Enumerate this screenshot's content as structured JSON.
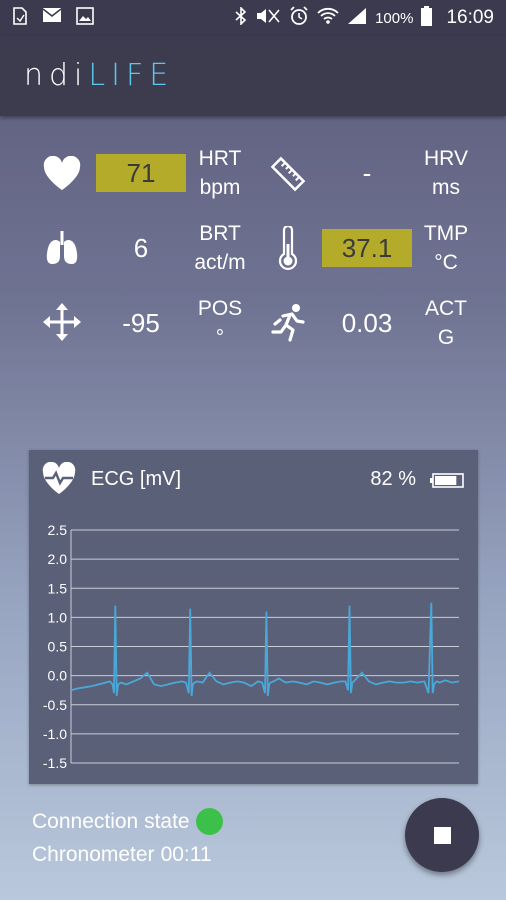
{
  "status_bar": {
    "left_icons": [
      "sim-icon",
      "mail-icon",
      "image-icon"
    ],
    "right_icons": [
      "bluetooth-icon",
      "mute-icon",
      "alarm-icon",
      "wifi-icon",
      "signal-icon"
    ],
    "battery_percent": "100%",
    "time": "16:09"
  },
  "app": {
    "logo_part1": "ndi",
    "logo_part2": "LIFE"
  },
  "metrics": {
    "hrt": {
      "icon": "heart-icon",
      "value": "71",
      "unit_line1": "HRT",
      "unit_line2": "bpm",
      "highlighted": true
    },
    "hrv": {
      "icon": "ruler-icon",
      "value": "-",
      "unit_line1": "HRV",
      "unit_line2": "ms",
      "highlighted": false
    },
    "brt": {
      "icon": "lungs-icon",
      "value": "6",
      "unit_line1": "BRT",
      "unit_line2": "act/m",
      "highlighted": false
    },
    "tmp": {
      "icon": "thermometer-icon",
      "value": "37.1",
      "unit_line1": "TMP",
      "unit_line2": "°C",
      "highlighted": true
    },
    "pos": {
      "icon": "move-arrows-icon",
      "value": "-95",
      "unit_line1": "POS",
      "unit_line2": "°",
      "highlighted": false
    },
    "act": {
      "icon": "running-icon",
      "value": "0.03",
      "unit_line1": "ACT",
      "unit_line2": "G",
      "highlighted": false
    }
  },
  "ecg": {
    "title": "ECG [mV]",
    "battery": "82 %",
    "battery_level": 0.82
  },
  "chart_data": {
    "type": "line",
    "title": "ECG [mV]",
    "xlabel": "",
    "ylabel": "",
    "ylim": [
      -1.5,
      2.5
    ],
    "yticks": [
      "2.5",
      "2.0",
      "1.5",
      "1.0",
      "0.5",
      "0.0",
      "-0.5",
      "-1.0",
      "-1.5"
    ],
    "grid": true,
    "series": [
      {
        "color": "#4aa8d8",
        "x": [
          0,
          5,
          10,
          15,
          20,
          25,
          28,
          30,
          31,
          32,
          33,
          34,
          36,
          40,
          50,
          55,
          60,
          65,
          70,
          75,
          80,
          83,
          85,
          86,
          87,
          88,
          89,
          91,
          95,
          100,
          105,
          110,
          115,
          120,
          125,
          130,
          135,
          138,
          140,
          141,
          142,
          143,
          144,
          146,
          150,
          155,
          160,
          165,
          170,
          175,
          180,
          185,
          190,
          195,
          198,
          200,
          201,
          202,
          203,
          204,
          206,
          210,
          215,
          220,
          225,
          230,
          235,
          240,
          245,
          250,
          255,
          258,
          260,
          261,
          262,
          263,
          264,
          266,
          270,
          275,
          280
        ],
        "values": [
          -0.25,
          -0.22,
          -0.2,
          -0.18,
          -0.15,
          -0.12,
          -0.1,
          -0.15,
          -0.3,
          1.2,
          -0.35,
          -0.15,
          -0.12,
          -0.15,
          -0.05,
          0.05,
          -0.15,
          -0.18,
          -0.15,
          -0.12,
          -0.1,
          -0.12,
          -0.3,
          1.15,
          -0.35,
          -0.15,
          -0.12,
          -0.1,
          -0.12,
          0.05,
          -0.1,
          -0.15,
          -0.12,
          -0.1,
          -0.12,
          -0.18,
          -0.1,
          -0.12,
          -0.3,
          1.1,
          -0.35,
          -0.15,
          -0.12,
          -0.1,
          -0.05,
          -0.12,
          -0.1,
          -0.12,
          -0.15,
          -0.1,
          -0.12,
          -0.15,
          -0.12,
          -0.1,
          -0.1,
          -0.25,
          1.2,
          -0.3,
          -0.12,
          -0.1,
          -0.05,
          0.05,
          -0.1,
          -0.15,
          -0.12,
          -0.1,
          -0.12,
          -0.12,
          -0.1,
          -0.12,
          -0.1,
          -0.3,
          1.25,
          -0.3,
          -0.15,
          -0.12,
          -0.1,
          -0.12,
          -0.08,
          -0.12,
          -0.1
        ]
      }
    ]
  },
  "footer": {
    "connection_label": "Connection state",
    "connection_color": "#3cc04a",
    "chrono_label": "Chronometer",
    "chrono_value": "00:11"
  },
  "fab": {
    "icon": "stop-icon"
  }
}
